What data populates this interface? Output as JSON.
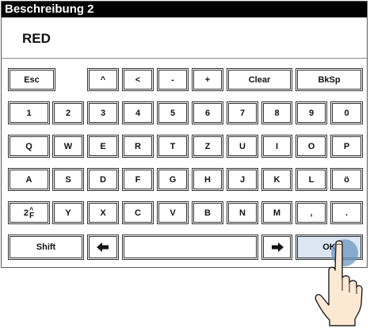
{
  "dialog": {
    "title": "Beschreibung 2",
    "value": "RED"
  },
  "keyboard": {
    "row1": [
      "Esc",
      "^",
      "<",
      "-",
      "+",
      "Clear",
      "BkSp"
    ],
    "row2": [
      "1",
      "2",
      "3",
      "4",
      "5",
      "6",
      "7",
      "8",
      "9",
      "0"
    ],
    "row3": [
      "Q",
      "W",
      "E",
      "R",
      "T",
      "Z",
      "U",
      "I",
      "O",
      "P"
    ],
    "row4": [
      "A",
      "S",
      "D",
      "F",
      "G",
      "H",
      "J",
      "K",
      "L",
      "ö"
    ],
    "row5": [
      "2^F",
      "Y",
      "X",
      "C",
      "V",
      "B",
      "N",
      "M",
      ",",
      "."
    ],
    "row6": {
      "shift": "Shift",
      "left_icon": "arrow-left-icon",
      "space": "",
      "right_icon": "arrow-right-icon",
      "ok": "OK"
    },
    "fn_key": {
      "main": "2",
      "upper": "^",
      "lower": "F"
    }
  },
  "colors": {
    "titlebar": "#000000",
    "ok_key_bg": "#dce6f2",
    "touch_indicator": "#6e96c3"
  },
  "overlay": {
    "pointer": "hand-pointer-icon"
  }
}
